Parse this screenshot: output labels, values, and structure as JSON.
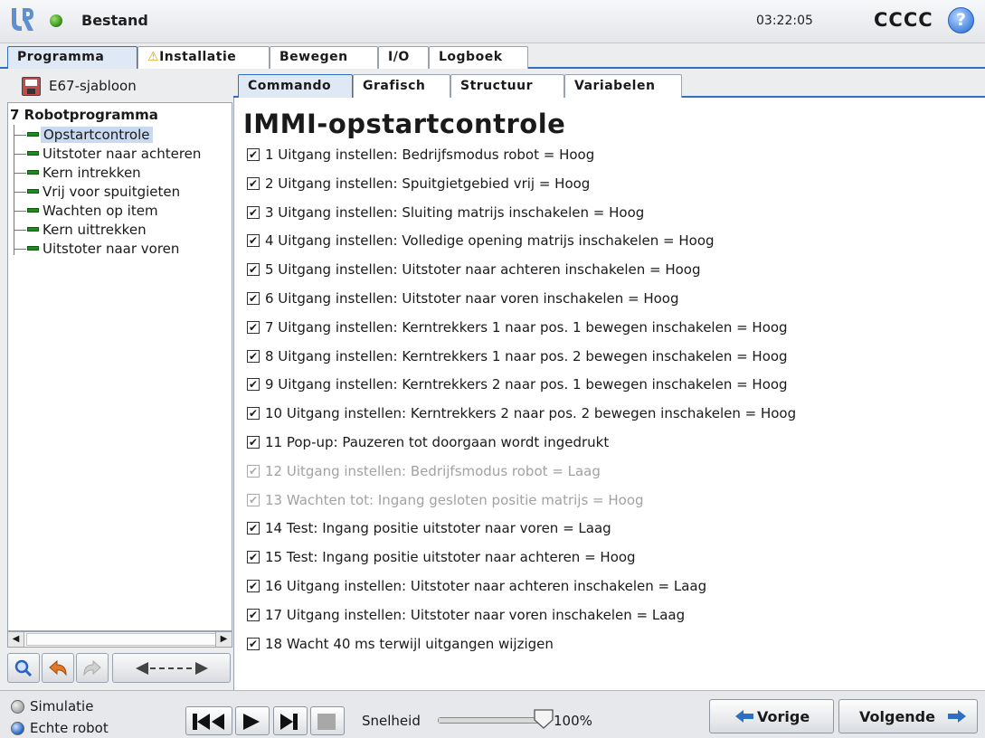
{
  "header": {
    "file_title": "Bestand",
    "time": "03:22:05",
    "robot_name": "CCCC",
    "help_label": "?"
  },
  "main_tabs": [
    {
      "label": "Programma",
      "active": true
    },
    {
      "label": "Installatie",
      "warning": true
    },
    {
      "label": "Bewegen"
    },
    {
      "label": "I/O"
    },
    {
      "label": "Logboek"
    }
  ],
  "program": {
    "name": "E67-sjabloon",
    "root": "Robotprogramma",
    "items": [
      {
        "label": "Opstartcontrole",
        "selected": true
      },
      {
        "label": "Uitstoter naar achteren"
      },
      {
        "label": "Kern intrekken"
      },
      {
        "label": "Vrij voor spuitgieten"
      },
      {
        "label": "Wachten op item"
      },
      {
        "label": "Kern uittrekken"
      },
      {
        "label": "Uitstoter naar voren"
      }
    ]
  },
  "sub_tabs": [
    {
      "label": "Commando",
      "active": true
    },
    {
      "label": "Grafisch"
    },
    {
      "label": "Structuur"
    },
    {
      "label": "Variabelen"
    }
  ],
  "content": {
    "title": "IMMI-opstartcontrole",
    "commands": [
      {
        "text": "1 Uitgang instellen: Bedrijfsmodus robot = Hoog",
        "enabled": true
      },
      {
        "text": "2 Uitgang instellen: Spuitgietgebied vrij = Hoog",
        "enabled": true
      },
      {
        "text": "3 Uitgang instellen: Sluiting matrijs inschakelen = Hoog",
        "enabled": true
      },
      {
        "text": "4 Uitgang instellen: Volledige opening matrijs inschakelen = Hoog",
        "enabled": true
      },
      {
        "text": "5 Uitgang instellen: Uitstoter naar achteren inschakelen = Hoog",
        "enabled": true
      },
      {
        "text": "6 Uitgang instellen: Uitstoter naar voren inschakelen = Hoog",
        "enabled": true
      },
      {
        "text": "7 Uitgang instellen: Kerntrekkers 1 naar pos. 1 bewegen inschakelen = Hoog",
        "enabled": true
      },
      {
        "text": "8 Uitgang instellen: Kerntrekkers 1 naar pos. 2 bewegen inschakelen = Hoog",
        "enabled": true
      },
      {
        "text": "9 Uitgang instellen: Kerntrekkers 2 naar pos. 1 bewegen inschakelen = Hoog",
        "enabled": true
      },
      {
        "text": "10 Uitgang instellen: Kerntrekkers 2 naar pos. 2 bewegen inschakelen = Hoog",
        "enabled": true
      },
      {
        "text": "11 Pop-up: Pauzeren tot doorgaan wordt ingedrukt",
        "enabled": true
      },
      {
        "text": "12 Uitgang instellen: Bedrijfsmodus robot = Laag",
        "enabled": false
      },
      {
        "text": "13 Wachten tot: Ingang gesloten positie matrijs = Hoog",
        "enabled": false
      },
      {
        "text": "14 Test: Ingang positie uitstoter naar voren = Laag",
        "enabled": true
      },
      {
        "text": "15 Test: Ingang positie uitstoter naar achteren = Hoog",
        "enabled": true
      },
      {
        "text": "16 Uitgang instellen: Uitstoter naar achteren inschakelen = Laag",
        "enabled": true
      },
      {
        "text": "17 Uitgang instellen: Uitstoter naar voren inschakelen = Laag",
        "enabled": true
      },
      {
        "text": "18 Wacht 40 ms terwijl uitgangen wijzigen",
        "enabled": true
      }
    ]
  },
  "footer": {
    "mode_simulation": "Simulatie",
    "mode_real": "Echte robot",
    "speed_label": "Snelheid",
    "speed_value": "100%",
    "speed_fraction": 1.0,
    "prev_label": "Vorige",
    "next_label": "Volgende"
  },
  "colors": {
    "accent": "#2f6fbf",
    "status_green": "#2f8a14",
    "selection": "#c9d9f0"
  }
}
